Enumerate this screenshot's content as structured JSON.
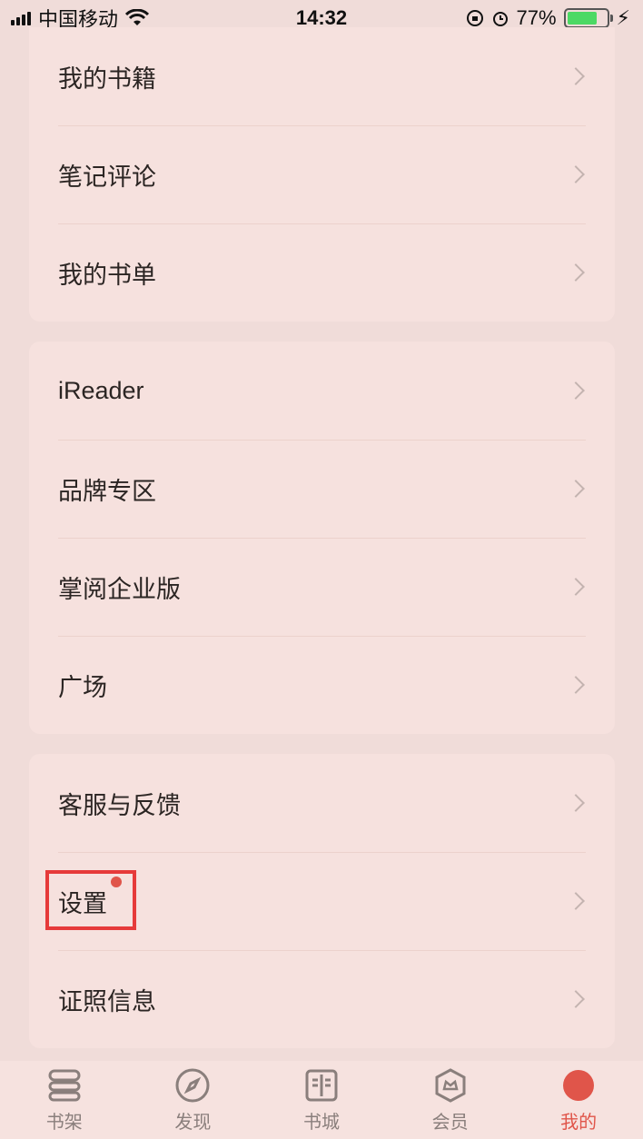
{
  "status": {
    "carrier": "中国移动",
    "time": "14:32",
    "battery": "77%",
    "battery_level": 0.77
  },
  "groups": [
    [
      {
        "label": "我的书籍"
      },
      {
        "label": "笔记评论"
      },
      {
        "label": "我的书单"
      }
    ],
    [
      {
        "label": "iReader"
      },
      {
        "label": "品牌专区"
      },
      {
        "label": "掌阅企业版"
      },
      {
        "label": "广场"
      }
    ],
    [
      {
        "label": "客服与反馈"
      },
      {
        "label": "设置"
      },
      {
        "label": "证照信息"
      }
    ]
  ],
  "tabs": [
    {
      "label": "书架",
      "icon": "bookshelf-icon"
    },
    {
      "label": "发现",
      "icon": "compass-icon"
    },
    {
      "label": "书城",
      "icon": "book-store-icon"
    },
    {
      "label": "会员",
      "icon": "vip-icon"
    },
    {
      "label": "我的",
      "icon": "profile-icon"
    }
  ],
  "colors": {
    "accent": "#e0554a",
    "highlight": "#e63a3a"
  }
}
